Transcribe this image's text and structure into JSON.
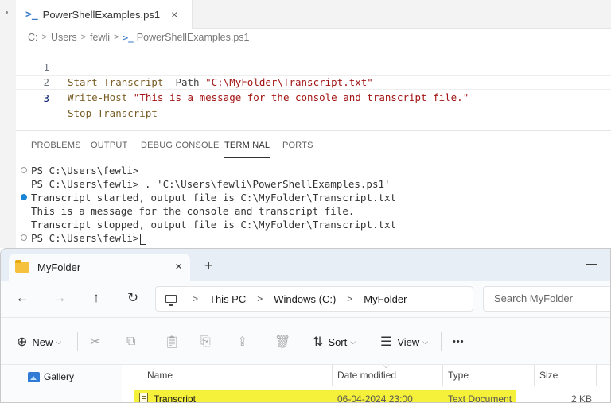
{
  "editor": {
    "tab_title": "PowerShellExamples.ps1",
    "tab_icon": ">_",
    "close_glyph": "×",
    "breadcrumb": [
      "C:",
      "Users",
      "fewli",
      "PowerShellExamples.ps1"
    ],
    "lines": [
      {
        "num": "1",
        "cmd": "Start-Transcript",
        "param": " -Path ",
        "str": "\"C:\\MyFolder\\Transcript.txt\""
      },
      {
        "num": "2",
        "cmd": "Write-Host",
        "param": " ",
        "str": "\"This is a message for the console and transcript file.\""
      },
      {
        "num": "3",
        "cmd": "Stop-Transcript",
        "param": "",
        "str": ""
      }
    ]
  },
  "panel": {
    "tabs": [
      "PROBLEMS",
      "OUTPUT",
      "DEBUG CONSOLE",
      "TERMINAL",
      "PORTS"
    ],
    "active_tab": "TERMINAL"
  },
  "terminal": {
    "lines": [
      "PS C:\\Users\\fewli>",
      "PS C:\\Users\\fewli> . 'C:\\Users\\fewli\\PowerShellExamples.ps1'",
      "Transcript started, output file is C:\\MyFolder\\Transcript.txt",
      "This is a message for the console and transcript file.",
      "Transcript stopped, output file is C:\\MyFolder\\Transcript.txt",
      "PS C:\\Users\\fewli>"
    ]
  },
  "explorer": {
    "tab_title": "MyFolder",
    "close_glyph": "×",
    "new_tab_glyph": "+",
    "minimize_glyph": "—",
    "nav": {
      "back": "←",
      "forward": "→",
      "up": "↑",
      "refresh": "↻"
    },
    "address": [
      "This PC",
      "Windows (C:)",
      "MyFolder"
    ],
    "address_sep": ">",
    "search_placeholder": "Search MyFolder",
    "toolbar": {
      "new_label": "New",
      "sort_label": "Sort",
      "view_label": "View",
      "more_glyph": "•••"
    },
    "sidebar": {
      "gallery_label": "Gallery"
    },
    "columns": [
      "Name",
      "Date modified",
      "Type",
      "Size"
    ],
    "files": [
      {
        "name": "Transcript",
        "date": "06-04-2024 23:00",
        "type": "Text Document",
        "size": "2 KB"
      }
    ],
    "highlight_color": "#f5f03a"
  }
}
